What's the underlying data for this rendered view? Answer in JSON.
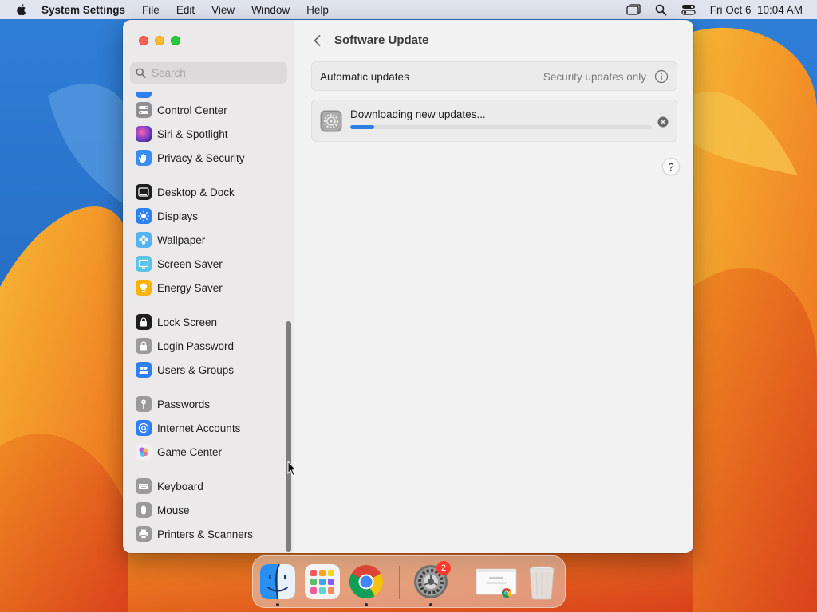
{
  "menubar": {
    "app_name": "System Settings",
    "menus": [
      "File",
      "Edit",
      "View",
      "Window",
      "Help"
    ],
    "datetime": "Fri Oct 6  10:04 AM"
  },
  "window": {
    "search_placeholder": "Search",
    "sidebar": {
      "items": [
        {
          "label": "Control Center",
          "icon": "control-center-icon",
          "color": "#8e8e93"
        },
        {
          "label": "Siri & Spotlight",
          "icon": "siri-icon",
          "color": "#7a3fd0"
        },
        {
          "label": "Privacy & Security",
          "icon": "hand-icon",
          "color": "#3a8cf0"
        },
        {
          "label": "Desktop & Dock",
          "icon": "desktop-dock-icon",
          "color": "#1d1d1f"
        },
        {
          "label": "Displays",
          "icon": "sun-icon",
          "color": "#2f7ff0"
        },
        {
          "label": "Wallpaper",
          "icon": "wallpaper-icon",
          "color": "#55b3f0"
        },
        {
          "label": "Screen Saver",
          "icon": "screen-saver-icon",
          "color": "#5cc2e8"
        },
        {
          "label": "Energy Saver",
          "icon": "lightbulb-icon",
          "color": "#f5b400"
        },
        {
          "label": "Lock Screen",
          "icon": "lock-icon",
          "color": "#1d1d1f"
        },
        {
          "label": "Login Password",
          "icon": "lock-gray-icon",
          "color": "#9a9a9a"
        },
        {
          "label": "Users & Groups",
          "icon": "users-icon",
          "color": "#2f7ff0"
        },
        {
          "label": "Passwords",
          "icon": "key-icon",
          "color": "#9a9a9a"
        },
        {
          "label": "Internet Accounts",
          "icon": "at-sign-icon",
          "color": "#2f7ff0"
        },
        {
          "label": "Game Center",
          "icon": "game-center-icon",
          "color": "#e8e8e8"
        },
        {
          "label": "Keyboard",
          "icon": "keyboard-icon",
          "color": "#9a9a9a"
        },
        {
          "label": "Mouse",
          "icon": "mouse-icon",
          "color": "#9a9a9a"
        },
        {
          "label": "Printers & Scanners",
          "icon": "printer-icon",
          "color": "#9a9a9a"
        }
      ]
    },
    "content": {
      "title": "Software Update",
      "automatic_updates": {
        "label": "Automatic updates",
        "value": "Security updates only"
      },
      "download": {
        "label": "Downloading new updates...",
        "progress": 0.08
      },
      "help_label": "?"
    }
  },
  "dock": {
    "apps": [
      "finder-icon",
      "launchpad-icon",
      "chrome-icon",
      "system-settings-icon",
      "chrome-window-thumbnail",
      "trash-icon"
    ],
    "settings_badge": "2"
  },
  "colors": {
    "accent": "#2f7ee6",
    "close": "#fe5f57",
    "minimize": "#febc2e",
    "maximize": "#28c840"
  }
}
